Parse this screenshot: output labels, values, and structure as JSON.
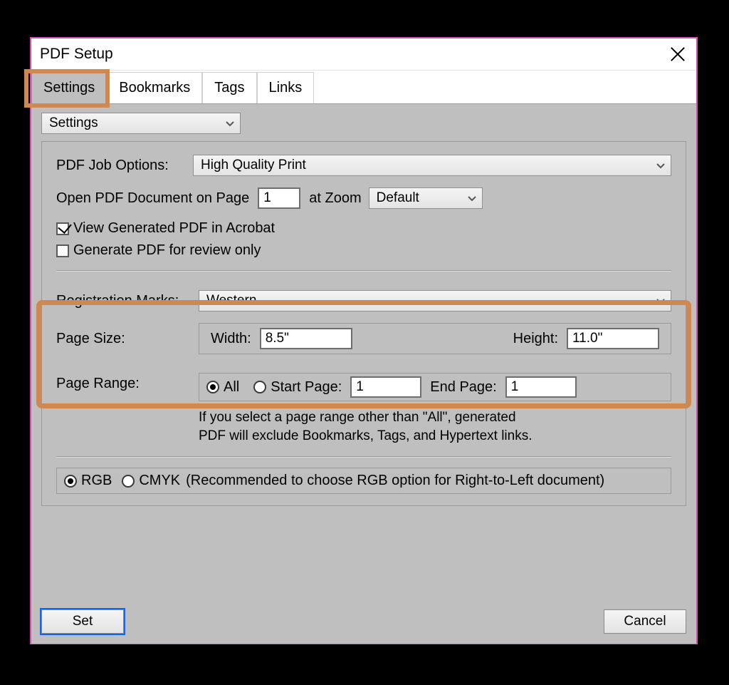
{
  "window": {
    "title": "PDF Setup"
  },
  "tabs": {
    "settings": "Settings",
    "bookmarks": "Bookmarks",
    "tags": "Tags",
    "links": "Links"
  },
  "settingsDropdown": "Settings",
  "jobOptions": {
    "label": "PDF Job Options:",
    "value": "High Quality Print"
  },
  "openDoc": {
    "prefix": "Open PDF Document on Page",
    "page": "1",
    "zoomPrefix": "at Zoom",
    "zoom": "Default"
  },
  "viewAcrobat": "View Generated PDF in Acrobat",
  "generateReview": "Generate PDF for review only",
  "reg": {
    "label": "Registration Marks:",
    "value": "Western"
  },
  "pageSize": {
    "label": "Page Size:",
    "widthLabel": "Width:",
    "width": "8.5\"",
    "heightLabel": "Height:",
    "height": "11.0\""
  },
  "pageRange": {
    "label": "Page Range:",
    "all": "All",
    "startLabel": "Start Page:",
    "start": "1",
    "endLabel": "End Page:",
    "end": "1",
    "note1": "If you select a page range other than \"All\",  generated",
    "note2": "PDF will exclude Bookmarks, Tags, and Hypertext links."
  },
  "color": {
    "rgb": "RGB",
    "cmyk": "CMYK",
    "note": "(Recommended to choose RGB option for Right-to-Left document)"
  },
  "buttons": {
    "set": "Set",
    "cancel": "Cancel"
  }
}
